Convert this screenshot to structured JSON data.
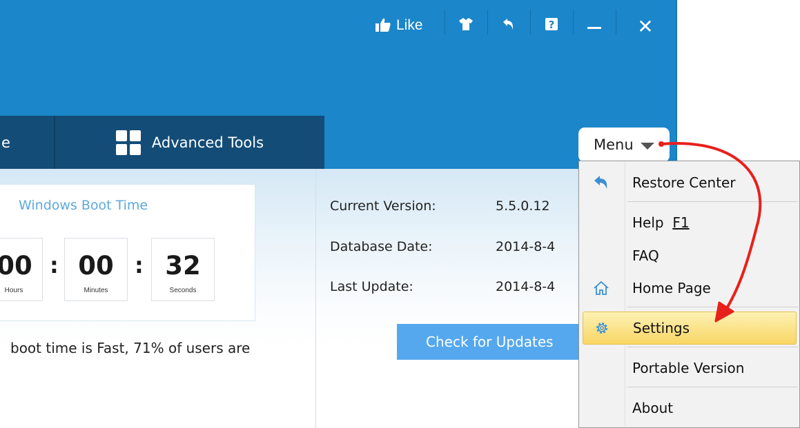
{
  "title_bar": {
    "like_label": "Like",
    "icons": [
      "thumbs-up-icon",
      "shirt-icon",
      "back-icon",
      "help-icon",
      "minimize-icon",
      "close-icon"
    ],
    "close_glyph": "✕"
  },
  "tabs": [
    {
      "label": "e"
    },
    {
      "label": "Advanced Tools"
    }
  ],
  "menu": {
    "button_label": "Menu",
    "items": [
      {
        "label": "Restore Center",
        "icon": "undo-arrow-icon"
      },
      {
        "label": "Help",
        "shortcut": "F1"
      },
      {
        "label": "FAQ"
      },
      {
        "label": "Home Page",
        "icon": "home-icon"
      },
      {
        "label": "Settings",
        "icon": "gear-icon",
        "highlighted": true
      },
      {
        "label": "Portable Version"
      },
      {
        "label": "About"
      }
    ]
  },
  "boot": {
    "title": "Windows Boot Time",
    "hours": "00",
    "hours_unit": "Hours",
    "minutes": "00",
    "minutes_unit": "Minutes",
    "seconds": "32",
    "seconds_unit": "Seconds",
    "colon": ":",
    "description": "boot time is Fast, 71% of users are"
  },
  "version_info": {
    "current_version_label": "Current Version:",
    "current_version_value": "5.5.0.12",
    "database_date_label": "Database Date:",
    "database_date_value": "2014-8-4",
    "last_update_label": "Last Update:",
    "last_update_value": "2014-8-4",
    "check_updates_label": "Check for Updates"
  },
  "colors": {
    "window_blue": "#1b86c9",
    "tab_dark": "#134d77",
    "update_button": "#55a8ee",
    "highlight": "#f9d665",
    "annotation_red": "#e8201c"
  }
}
